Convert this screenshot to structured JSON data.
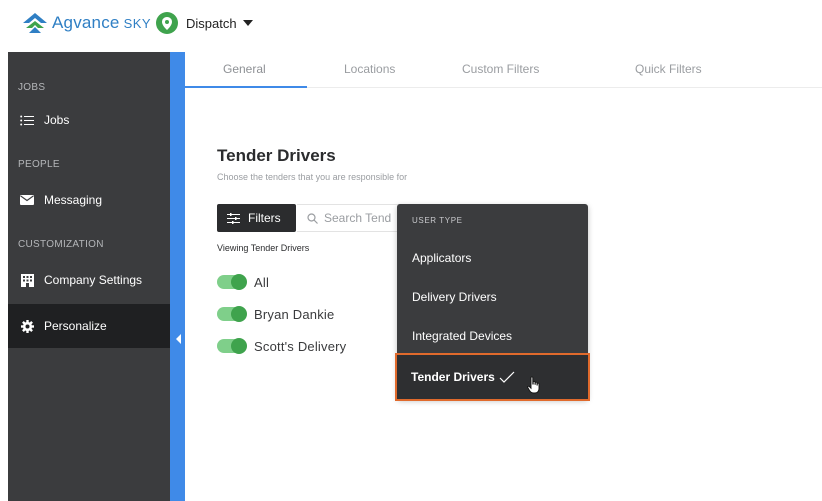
{
  "brand": {
    "name": "Agvance",
    "suffix": "SKY",
    "color": "#2f7fc4"
  },
  "app_switcher": {
    "label": "Dispatch"
  },
  "sidebar": {
    "sections": [
      {
        "label": "JOBS",
        "items": [
          {
            "label": "Jobs",
            "icon": "list-icon"
          }
        ]
      },
      {
        "label": "PEOPLE",
        "items": [
          {
            "label": "Messaging",
            "icon": "envelope-icon"
          }
        ]
      },
      {
        "label": "CUSTOMIZATION",
        "items": [
          {
            "label": "Company Settings",
            "icon": "building-icon"
          },
          {
            "label": "Personalize",
            "icon": "gear-icon",
            "active": true
          }
        ]
      }
    ],
    "accent": "#3f8ae8"
  },
  "tabs": [
    {
      "label": "General",
      "active": true
    },
    {
      "label": "Locations"
    },
    {
      "label": "Custom Filters"
    },
    {
      "label": "Quick Filters"
    }
  ],
  "page": {
    "title": "Tender Drivers",
    "subtitle": "Choose the tenders that you are responsible for",
    "filters_label": "Filters",
    "search_placeholder": "Search Tend",
    "viewing_label": "Viewing Tender Drivers"
  },
  "toggles": [
    {
      "label": "All",
      "on": true
    },
    {
      "label": "Bryan Dankie",
      "on": true
    },
    {
      "label": "Scott's Delivery",
      "on": true
    }
  ],
  "dropdown": {
    "header": "USER TYPE",
    "options": [
      {
        "label": "Applicators"
      },
      {
        "label": "Delivery Drivers"
      },
      {
        "label": "Integrated Devices"
      },
      {
        "label": "Tender Drivers",
        "selected": true
      }
    ],
    "highlight_color": "#e06a2c"
  }
}
